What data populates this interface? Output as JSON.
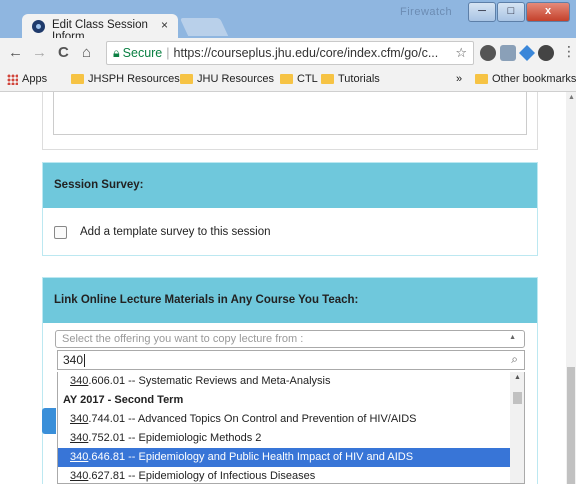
{
  "browser": {
    "tab_title": "Edit Class Session Inform",
    "tab_close": "×",
    "window_title": "Firewatch",
    "window_minimize": "─",
    "window_maximize": "□",
    "window_close": "x",
    "nav_back": "←",
    "nav_forward": "→",
    "nav_reload": "C",
    "nav_home": "⌂",
    "secure_label": "Secure",
    "url": "https://courseplus.jhu.edu/core/index.cfm/go/c...",
    "bookmark_star": "☆",
    "menu_dots": "⋮",
    "bookmarks": {
      "apps": "Apps",
      "items": [
        "JHSPH Resources",
        "JHU Resources",
        "CTL",
        "Tutorials"
      ],
      "overflow": "»",
      "other": "Other bookmarks"
    }
  },
  "session_survey": {
    "header": "Session Survey:",
    "checkbox_label": "Add a template survey to this session",
    "checked": false
  },
  "lecture_materials": {
    "header": "Link Online Lecture Materials in Any Course You Teach:",
    "select_placeholder": "Select the offering you want to copy lecture from :",
    "search_value": "340",
    "results": [
      {
        "match": "340",
        "rest": ".606.01 -- Systematic Reviews and Meta-Analysis",
        "group": false,
        "highlighted": false
      },
      {
        "text": "AY 2017 - Second Term",
        "group": true
      },
      {
        "match": "340",
        "rest": ".744.01 -- Advanced Topics On Control and Prevention of HIV/AIDS",
        "group": false,
        "highlighted": false
      },
      {
        "match": "340",
        "rest": ".752.01 -- Epidemiologic Methods 2",
        "group": false,
        "highlighted": false
      },
      {
        "match": "340",
        "rest": ".646.81 -- Epidemiology and Public Health Impact of HIV and AIDS",
        "group": false,
        "highlighted": true
      },
      {
        "match": "340",
        "rest": ".627.81 -- Epidemiology of Infectious Diseases",
        "group": false,
        "highlighted": false
      }
    ]
  },
  "colors": {
    "panel_header": "#6fc8dc",
    "highlight": "#3875d7",
    "secure_green": "#0b8043"
  }
}
